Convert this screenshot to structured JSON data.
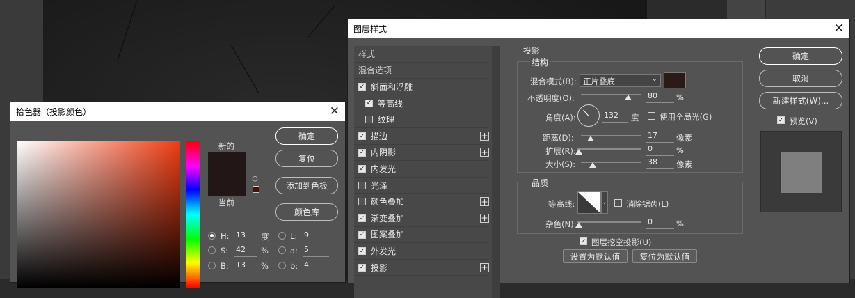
{
  "color_picker": {
    "title": "拾色器（投影颜色）",
    "label_new": "新的",
    "label_current": "当前",
    "buttons": {
      "ok": "确定",
      "reset": "复位",
      "add_to_swatches": "添加到色板",
      "color_libraries": "颜色库"
    },
    "fields": {
      "h": {
        "label": "H:",
        "value": "13",
        "unit": "度"
      },
      "s": {
        "label": "S:",
        "value": "42",
        "unit": "%"
      },
      "b": {
        "label": "B:",
        "value": "13",
        "unit": "%"
      },
      "l": {
        "label": "L:",
        "value": "9"
      },
      "a": {
        "label": "a:",
        "value": "5"
      },
      "lab_b": {
        "label": "b:",
        "value": "4"
      }
    },
    "colors": {
      "new": "#221716",
      "current": "#221716",
      "hue": "#f03b12"
    }
  },
  "layer_style": {
    "title": "图层样式",
    "list": [
      {
        "label": "样式",
        "checkbox": false,
        "plus": false,
        "indent": 0,
        "header": true
      },
      {
        "label": "混合选项",
        "checkbox": false,
        "plus": false,
        "indent": 0,
        "header": true
      },
      {
        "label": "斜面和浮雕",
        "checkbox": true,
        "checked": true,
        "plus": false,
        "indent": 0
      },
      {
        "label": "等高线",
        "checkbox": true,
        "checked": true,
        "plus": false,
        "indent": 1
      },
      {
        "label": "纹理",
        "checkbox": true,
        "checked": false,
        "plus": false,
        "indent": 1
      },
      {
        "label": "描边",
        "checkbox": true,
        "checked": true,
        "plus": true,
        "indent": 0
      },
      {
        "label": "内阴影",
        "checkbox": true,
        "checked": true,
        "plus": true,
        "indent": 0
      },
      {
        "label": "内发光",
        "checkbox": true,
        "checked": true,
        "plus": false,
        "indent": 0
      },
      {
        "label": "光泽",
        "checkbox": true,
        "checked": false,
        "plus": false,
        "indent": 0
      },
      {
        "label": "颜色叠加",
        "checkbox": true,
        "checked": false,
        "plus": true,
        "indent": 0
      },
      {
        "label": "渐变叠加",
        "checkbox": true,
        "checked": true,
        "plus": true,
        "indent": 0
      },
      {
        "label": "图案叠加",
        "checkbox": true,
        "checked": true,
        "plus": false,
        "indent": 0
      },
      {
        "label": "外发光",
        "checkbox": true,
        "checked": true,
        "plus": false,
        "indent": 0
      },
      {
        "label": "投影",
        "checkbox": true,
        "checked": true,
        "plus": true,
        "indent": 0
      }
    ],
    "drop_shadow": {
      "section": "投影",
      "structure": "结构",
      "blend_mode_label": "混合模式(B):",
      "blend_mode_value": "正片叠底",
      "shadow_color": "#2a1b19",
      "opacity_label": "不透明度(O):",
      "opacity_value": "80",
      "opacity_unit": "%",
      "opacity_fraction": 0.8,
      "angle_label": "角度(A):",
      "angle_value": "132",
      "angle_unit": "度",
      "global_light_label": "使用全局光(G)",
      "distance_label": "距离(D):",
      "distance_value": "17",
      "distance_unit": "像素",
      "spread_label": "扩展(R):",
      "spread_value": "0",
      "spread_unit": "%",
      "size_label": "大小(S):",
      "size_value": "38",
      "size_unit": "像素",
      "quality": "品质",
      "contour_label": "等高线:",
      "anti_alias_label": "消除锯齿(L)",
      "noise_label": "杂色(N):",
      "noise_value": "0",
      "noise_unit": "%",
      "knockout_label": "图层挖空投影(U)",
      "make_default": "设置为默认值",
      "reset_default": "复位为默认值"
    },
    "buttons": {
      "ok": "确定",
      "cancel": "取消",
      "new_style": "新建样式(W)...",
      "preview": "预览(V)"
    }
  }
}
